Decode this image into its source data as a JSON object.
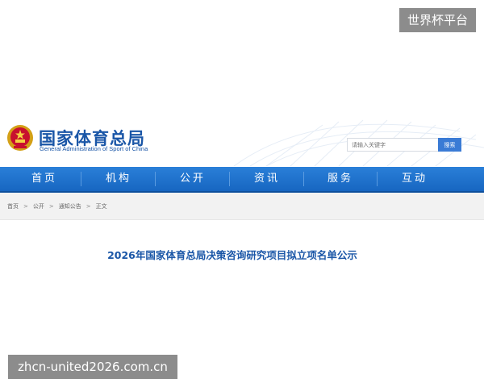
{
  "watermark_top": "世界杯平台",
  "watermark_bottom": "zhcn-united2026.com.cn",
  "header": {
    "title": "国家体育总局",
    "subtitle": "General Administration of Sport of China",
    "emblem_icon": "national-emblem-icon",
    "search": {
      "placeholder": "请输入关键字",
      "button_label": "搜索"
    }
  },
  "nav": {
    "items": [
      {
        "label": "首页"
      },
      {
        "label": "机构"
      },
      {
        "label": "公开"
      },
      {
        "label": "资讯"
      },
      {
        "label": "服务"
      },
      {
        "label": "互动"
      }
    ]
  },
  "breadcrumb": {
    "items": [
      "首页",
      "公开",
      "通知公告",
      "正文"
    ],
    "separator": ">"
  },
  "article": {
    "title": "2026年国家体育总局决策咨询研究项目拟立项名单公示"
  },
  "colors": {
    "brand_blue": "#1a56a7",
    "nav_blue": "#1766c1",
    "search_button": "#3a7bd5",
    "breadcrumb_bg": "#f2f2f2",
    "watermark_bg": "#8c8c8c"
  }
}
